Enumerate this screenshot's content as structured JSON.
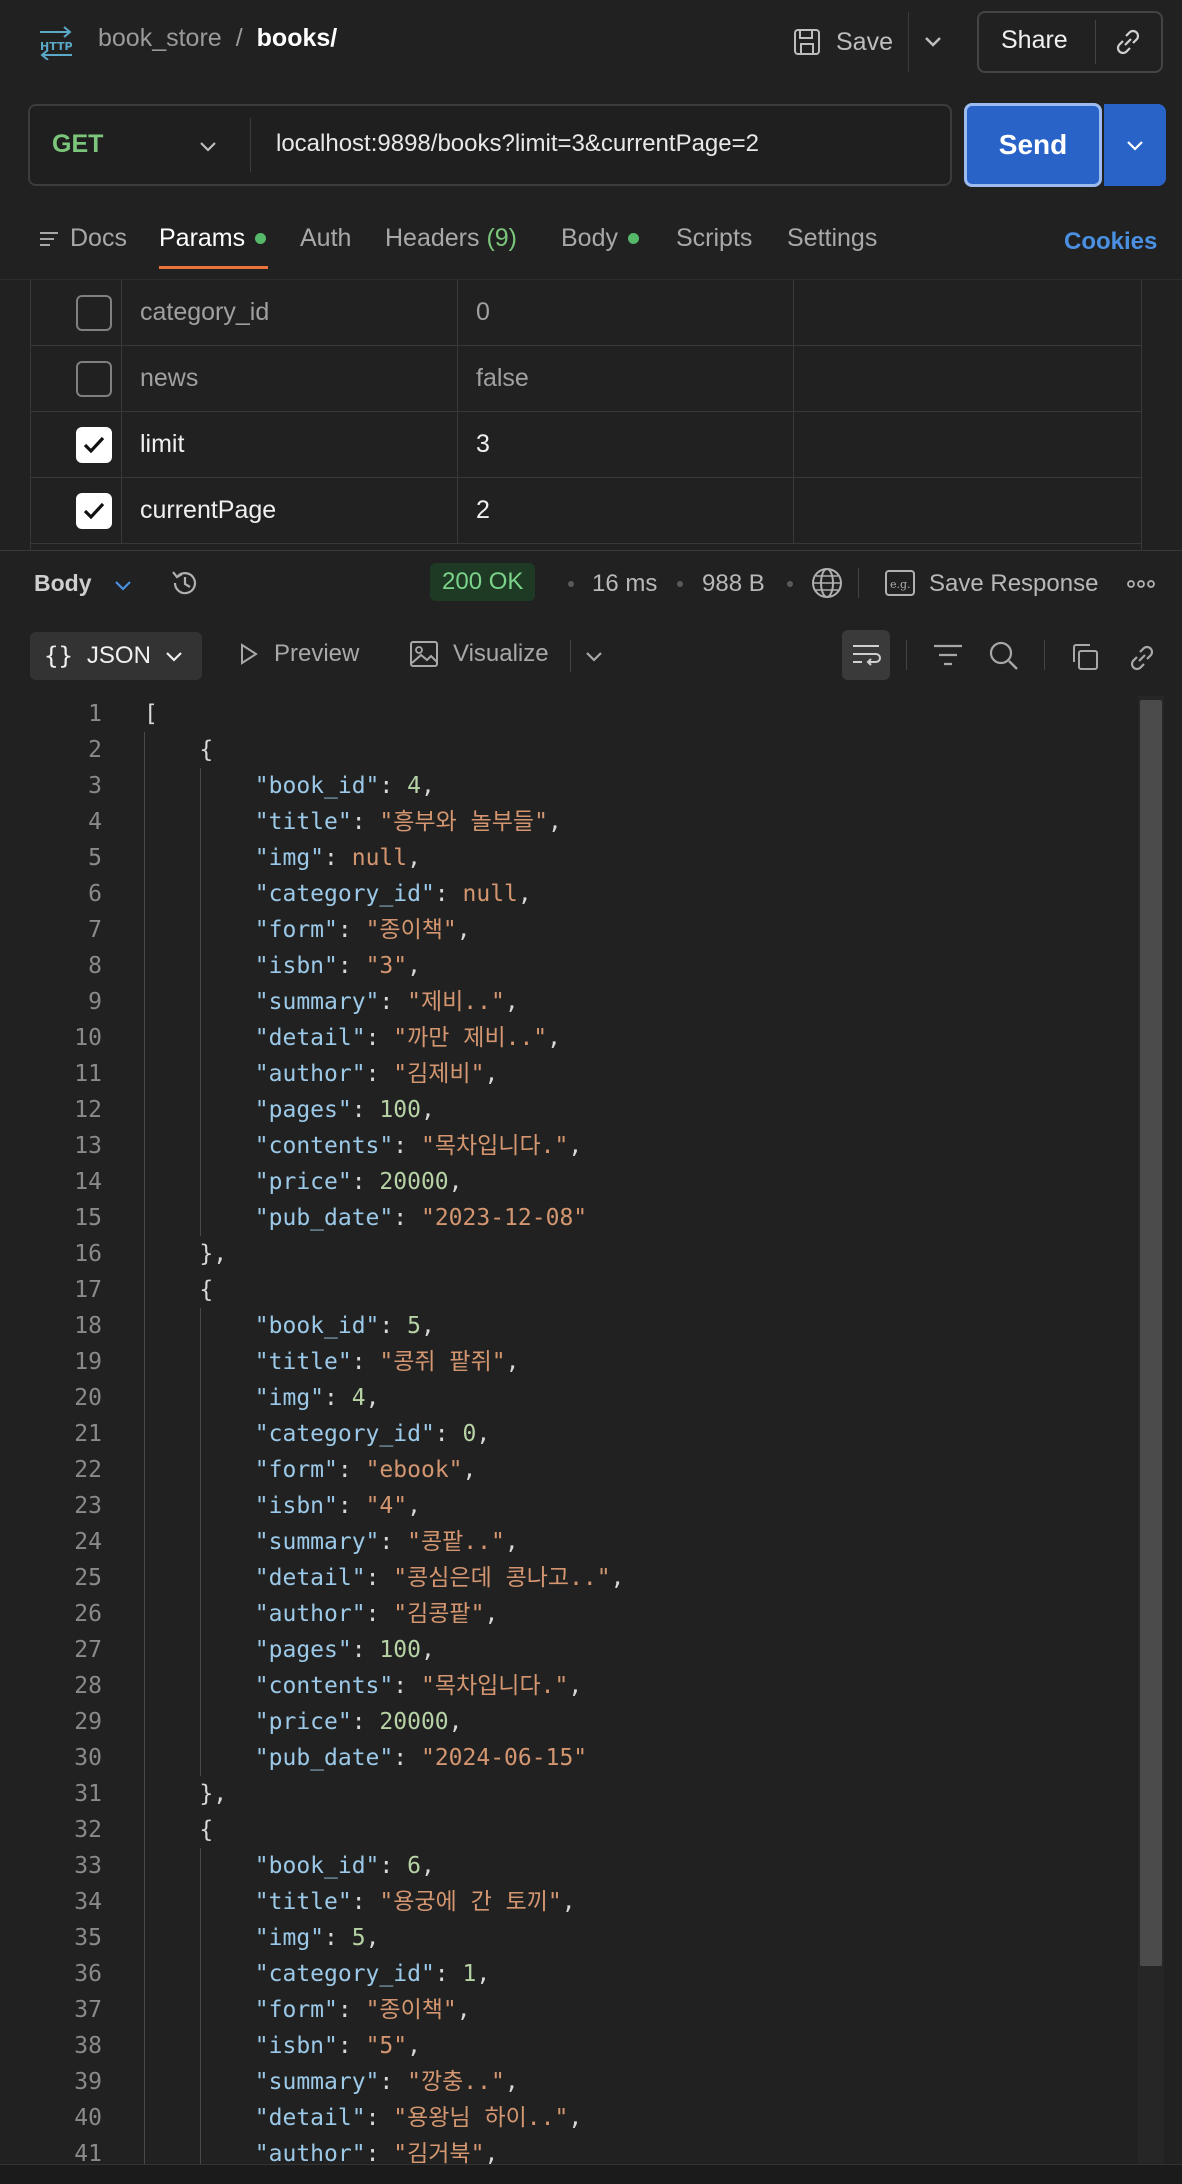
{
  "breadcrumb": {
    "workspace": "book_store",
    "separator": "/",
    "current": "books/"
  },
  "toolbar": {
    "save_label": "Save",
    "share_label": "Share"
  },
  "request": {
    "method": "GET",
    "url": "localhost:9898/books?limit=3&currentPage=2",
    "send_label": "Send"
  },
  "tabs": [
    {
      "label": "Docs"
    },
    {
      "label": "Params"
    },
    {
      "label": "Auth"
    },
    {
      "label": "Headers",
      "count": "(9)"
    },
    {
      "label": "Body"
    },
    {
      "label": "Scripts"
    },
    {
      "label": "Settings"
    }
  ],
  "cookies_label": "Cookies",
  "params": [
    {
      "key": "category_id",
      "value": "0",
      "checked": false
    },
    {
      "key": "news",
      "value": "false",
      "checked": false
    },
    {
      "key": "limit",
      "value": "3",
      "checked": true
    },
    {
      "key": "currentPage",
      "value": "2",
      "checked": true
    }
  ],
  "response": {
    "body_label": "Body",
    "status": "200 OK",
    "time": "16 ms",
    "size": "988 B",
    "save_response_label": "Save Response"
  },
  "viewer": {
    "format_label": "JSON",
    "preview_label": "Preview",
    "visualize_label": "Visualize"
  },
  "code_lines": [
    "[",
    "    {",
    "        \"book_id\": 4,",
    "        \"title\": \"흥부와 놀부들\",",
    "        \"img\": null,",
    "        \"category_id\": null,",
    "        \"form\": \"종이책\",",
    "        \"isbn\": \"3\",",
    "        \"summary\": \"제비..\",",
    "        \"detail\": \"까만 제비..\",",
    "        \"author\": \"김제비\",",
    "        \"pages\": 100,",
    "        \"contents\": \"목차입니다.\",",
    "        \"price\": 20000,",
    "        \"pub_date\": \"2023-12-08\"",
    "    },",
    "    {",
    "        \"book_id\": 5,",
    "        \"title\": \"콩쥐 팥쥐\",",
    "        \"img\": 4,",
    "        \"category_id\": 0,",
    "        \"form\": \"ebook\",",
    "        \"isbn\": \"4\",",
    "        \"summary\": \"콩팥..\",",
    "        \"detail\": \"콩심은데 콩나고..\",",
    "        \"author\": \"김콩팥\",",
    "        \"pages\": 100,",
    "        \"contents\": \"목차입니다.\",",
    "        \"price\": 20000,",
    "        \"pub_date\": \"2024-06-15\"",
    "    },",
    "    {",
    "        \"book_id\": 6,",
    "        \"title\": \"용궁에 간 토끼\",",
    "        \"img\": 5,",
    "        \"category_id\": 1,",
    "        \"form\": \"종이책\",",
    "        \"isbn\": \"5\",",
    "        \"summary\": \"깡충..\",",
    "        \"detail\": \"용왕님 하이..\",",
    "        \"author\": \"김거북\","
  ],
  "icons": {
    "app": "http-icon",
    "save": "save-icon",
    "share_link": "link-icon",
    "history": "history-icon",
    "globe": "globe-icon",
    "more": "more-icon",
    "wrap": "wrap-icon",
    "filter": "filter-icon",
    "search": "search-icon",
    "copy": "copy-icon"
  },
  "colors": {
    "accent": "#2a63c8",
    "status_ok": "#7bd389",
    "method_get": "#7bc67b",
    "tab_underline": "#e8743b",
    "cookies": "#4a90e2"
  }
}
